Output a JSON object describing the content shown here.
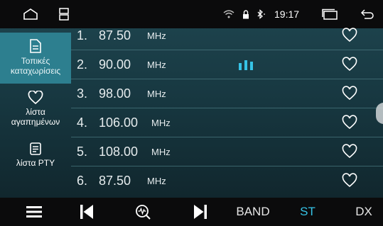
{
  "status_bar": {
    "time": "19:17",
    "icons": [
      "home-icon",
      "recent-apps-icon",
      "wifi-icon",
      "lock-icon",
      "bluetooth-icon",
      "multi-window-icon",
      "back-icon"
    ]
  },
  "sidebar": {
    "items": [
      {
        "label_line1": "Τοπικές",
        "label_line2": "καταχωρίσεις",
        "icon": "document-icon",
        "active": true
      },
      {
        "label_line1": "λίστα",
        "label_line2": "αγαπημένων",
        "icon": "heart-outline-icon",
        "active": false
      },
      {
        "label_line1": "λίστα PTY",
        "label_line2": "",
        "icon": "list-icon",
        "active": false
      }
    ]
  },
  "stations": [
    {
      "number": "1.",
      "frequency": "87.50",
      "unit": "MHz",
      "playing": false,
      "favorite_icon": "heart-outline-icon"
    },
    {
      "number": "2.",
      "frequency": "90.00",
      "unit": "MHz",
      "playing": true,
      "favorite_icon": "heart-outline-icon"
    },
    {
      "number": "3.",
      "frequency": "98.00",
      "unit": "MHz",
      "playing": false,
      "favorite_icon": "heart-outline-icon"
    },
    {
      "number": "4.",
      "frequency": "106.00",
      "unit": "MHz",
      "playing": false,
      "favorite_icon": "heart-outline-icon"
    },
    {
      "number": "5.",
      "frequency": "108.00",
      "unit": "MHz",
      "playing": false,
      "favorite_icon": "heart-outline-icon"
    },
    {
      "number": "6.",
      "frequency": "87.50",
      "unit": "MHz",
      "playing": false,
      "favorite_icon": "heart-outline-icon"
    }
  ],
  "toolbar": {
    "band_label": "BAND",
    "st_label": "ST",
    "dx_label": "DX",
    "icons": [
      "menu-icon",
      "previous-icon",
      "scan-icon",
      "next-icon"
    ]
  },
  "colors": {
    "accent": "#36c3e6",
    "active_tab": "#2d7f8f",
    "background_top": "#1f4650",
    "background_bottom": "#0f2228",
    "bar": "#0b0b0c"
  }
}
